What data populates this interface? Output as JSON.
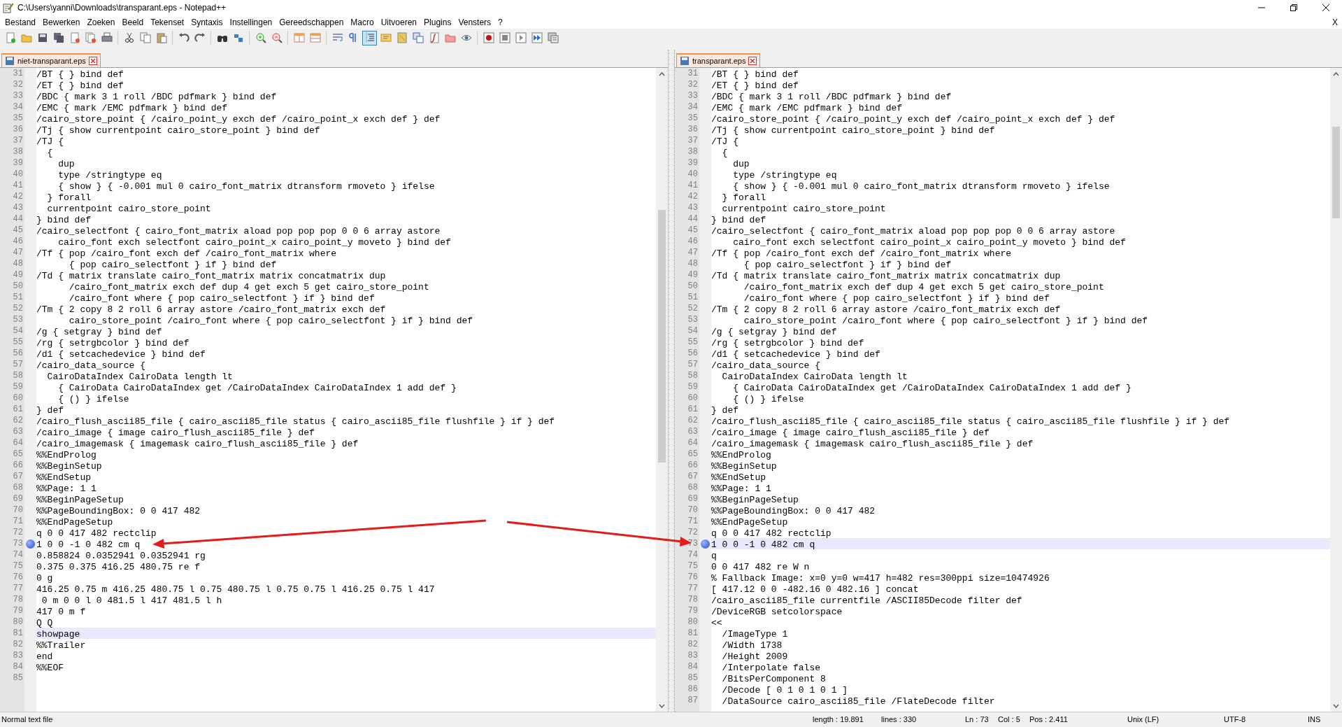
{
  "window": {
    "title": "C:\\Users\\yanni\\Downloads\\transparant.eps - Notepad++"
  },
  "menu": [
    "Bestand",
    "Bewerken",
    "Zoeken",
    "Beeld",
    "Tekenset",
    "Syntaxis",
    "Instellingen",
    "Gereedschappen",
    "Macro",
    "Uitvoeren",
    "Plugins",
    "Vensters",
    "?"
  ],
  "menu_close": "X",
  "toolbar": [
    {
      "pressed": false
    },
    {
      "pressed": false
    },
    {
      "pressed": false
    },
    {
      "pressed": false
    },
    {
      "pressed": false
    },
    {
      "pressed": false
    },
    {
      "pressed": false
    },
    {
      "pressed": false
    },
    {
      "pressed": false
    },
    {
      "pressed": false
    },
    {
      "pressed": false
    },
    {
      "pressed": false
    },
    {
      "pressed": false
    },
    {
      "pressed": false
    },
    {
      "pressed": false
    },
    {
      "pressed": false
    },
    {
      "pressed": false
    },
    {
      "pressed": false
    },
    {
      "pressed": false
    },
    {
      "pressed": false
    },
    {
      "pressed": true
    },
    {
      "pressed": false
    },
    {
      "pressed": false
    },
    {
      "pressed": false
    },
    {
      "pressed": false
    },
    {
      "pressed": false
    },
    {
      "pressed": false
    },
    {
      "pressed": false
    },
    {
      "pressed": false
    },
    {
      "pressed": false
    },
    {
      "pressed": false
    },
    {
      "pressed": false
    }
  ],
  "panes": [
    {
      "tab": {
        "label": "niet-transparant.eps",
        "selected": true
      },
      "lines": [
        {
          "n": "31",
          "text": "/BT { } bind def",
          "bookmark": false,
          "current": false
        },
        {
          "n": "32",
          "text": "/ET { } bind def",
          "bookmark": false,
          "current": false
        },
        {
          "n": "33",
          "text": "/BDC { mark 3 1 roll /BDC pdfmark } bind def",
          "bookmark": false,
          "current": false
        },
        {
          "n": "34",
          "text": "/EMC { mark /EMC pdfmark } bind def",
          "bookmark": false,
          "current": false
        },
        {
          "n": "35",
          "text": "/cairo_store_point { /cairo_point_y exch def /cairo_point_x exch def } def",
          "bookmark": false,
          "current": false
        },
        {
          "n": "36",
          "text": "/Tj { show currentpoint cairo_store_point } bind def",
          "bookmark": false,
          "current": false
        },
        {
          "n": "37",
          "text": "/TJ {",
          "bookmark": false,
          "current": false
        },
        {
          "n": "38",
          "text": "  {",
          "bookmark": false,
          "current": false
        },
        {
          "n": "39",
          "text": "    dup",
          "bookmark": false,
          "current": false
        },
        {
          "n": "40",
          "text": "    type /stringtype eq",
          "bookmark": false,
          "current": false
        },
        {
          "n": "41",
          "text": "    { show } { -0.001 mul 0 cairo_font_matrix dtransform rmoveto } ifelse",
          "bookmark": false,
          "current": false
        },
        {
          "n": "42",
          "text": "  } forall",
          "bookmark": false,
          "current": false
        },
        {
          "n": "43",
          "text": "  currentpoint cairo_store_point",
          "bookmark": false,
          "current": false
        },
        {
          "n": "44",
          "text": "} bind def",
          "bookmark": false,
          "current": false
        },
        {
          "n": "45",
          "text": "/cairo_selectfont { cairo_font_matrix aload pop pop pop 0 0 6 array astore",
          "bookmark": false,
          "current": false
        },
        {
          "n": "46",
          "text": "    cairo_font exch selectfont cairo_point_x cairo_point_y moveto } bind def",
          "bookmark": false,
          "current": false
        },
        {
          "n": "47",
          "text": "/Tf { pop /cairo_font exch def /cairo_font_matrix where",
          "bookmark": false,
          "current": false
        },
        {
          "n": "48",
          "text": "      { pop cairo_selectfont } if } bind def",
          "bookmark": false,
          "current": false
        },
        {
          "n": "49",
          "text": "/Td { matrix translate cairo_font_matrix matrix concatmatrix dup",
          "bookmark": false,
          "current": false
        },
        {
          "n": "50",
          "text": "      /cairo_font_matrix exch def dup 4 get exch 5 get cairo_store_point",
          "bookmark": false,
          "current": false
        },
        {
          "n": "51",
          "text": "      /cairo_font where { pop cairo_selectfont } if } bind def",
          "bookmark": false,
          "current": false
        },
        {
          "n": "52",
          "text": "/Tm { 2 copy 8 2 roll 6 array astore /cairo_font_matrix exch def",
          "bookmark": false,
          "current": false
        },
        {
          "n": "53",
          "text": "      cairo_store_point /cairo_font where { pop cairo_selectfont } if } bind def",
          "bookmark": false,
          "current": false
        },
        {
          "n": "54",
          "text": "/g { setgray } bind def",
          "bookmark": false,
          "current": false
        },
        {
          "n": "55",
          "text": "/rg { setrgbcolor } bind def",
          "bookmark": false,
          "current": false
        },
        {
          "n": "56",
          "text": "/d1 { setcachedevice } bind def",
          "bookmark": false,
          "current": false
        },
        {
          "n": "57",
          "text": "/cairo_data_source {",
          "bookmark": false,
          "current": false
        },
        {
          "n": "58",
          "text": "  CairoDataIndex CairoData length lt",
          "bookmark": false,
          "current": false
        },
        {
          "n": "59",
          "text": "    { CairoData CairoDataIndex get /CairoDataIndex CairoDataIndex 1 add def }",
          "bookmark": false,
          "current": false
        },
        {
          "n": "60",
          "text": "    { () } ifelse",
          "bookmark": false,
          "current": false
        },
        {
          "n": "61",
          "text": "} def",
          "bookmark": false,
          "current": false
        },
        {
          "n": "62",
          "text": "/cairo_flush_ascii85_file { cairo_ascii85_file status { cairo_ascii85_file flushfile } if } def",
          "bookmark": false,
          "current": false
        },
        {
          "n": "63",
          "text": "/cairo_image { image cairo_flush_ascii85_file } def",
          "bookmark": false,
          "current": false
        },
        {
          "n": "64",
          "text": "/cairo_imagemask { imagemask cairo_flush_ascii85_file } def",
          "bookmark": false,
          "current": false
        },
        {
          "n": "65",
          "text": "%%EndProlog",
          "bookmark": false,
          "current": false
        },
        {
          "n": "66",
          "text": "%%BeginSetup",
          "bookmark": false,
          "current": false
        },
        {
          "n": "67",
          "text": "%%EndSetup",
          "bookmark": false,
          "current": false
        },
        {
          "n": "68",
          "text": "%%Page: 1 1",
          "bookmark": false,
          "current": false
        },
        {
          "n": "69",
          "text": "%%BeginPageSetup",
          "bookmark": false,
          "current": false
        },
        {
          "n": "70",
          "text": "%%PageBoundingBox: 0 0 417 482",
          "bookmark": false,
          "current": false
        },
        {
          "n": "71",
          "text": "%%EndPageSetup",
          "bookmark": false,
          "current": false
        },
        {
          "n": "72",
          "text": "q 0 0 417 482 rectclip",
          "bookmark": false,
          "current": false
        },
        {
          "n": "73",
          "text": "1 0 0 -1 0 482 cm q",
          "bookmark": true,
          "current": false
        },
        {
          "n": "74",
          "text": "0.858824 0.0352941 0.0352941 rg",
          "bookmark": false,
          "current": false
        },
        {
          "n": "75",
          "text": "0.375 0.375 416.25 480.75 re f",
          "bookmark": false,
          "current": false
        },
        {
          "n": "76",
          "text": "0 g",
          "bookmark": false,
          "current": false
        },
        {
          "n": "77",
          "text": "416.25 0.75 m 416.25 480.75 l 0.75 480.75 l 0.75 0.75 l 416.25 0.75 l 417",
          "bookmark": false,
          "current": false
        },
        {
          "n": "78",
          "text": " 0 m 0 0 l 0 481.5 l 417 481.5 l h",
          "bookmark": false,
          "current": false
        },
        {
          "n": "79",
          "text": "417 0 m f",
          "bookmark": false,
          "current": false
        },
        {
          "n": "80",
          "text": "Q Q",
          "bookmark": false,
          "current": false
        },
        {
          "n": "81",
          "text": "showpage",
          "bookmark": false,
          "current": true
        },
        {
          "n": "82",
          "text": "%%Trailer",
          "bookmark": false,
          "current": false
        },
        {
          "n": "83",
          "text": "end",
          "bookmark": false,
          "current": false
        },
        {
          "n": "84",
          "text": "%%EOF",
          "bookmark": false,
          "current": false
        },
        {
          "n": "85",
          "bookmark": false,
          "current": false
        }
      ]
    },
    {
      "tab": {
        "label": "transparant.eps",
        "selected": true
      },
      "lines": [
        {
          "n": "31",
          "text": "/BT { } bind def",
          "bookmark": false,
          "current": false
        },
        {
          "n": "32",
          "text": "/ET { } bind def",
          "bookmark": false,
          "current": false
        },
        {
          "n": "33",
          "text": "/BDC { mark 3 1 roll /BDC pdfmark } bind def",
          "bookmark": false,
          "current": false
        },
        {
          "n": "34",
          "text": "/EMC { mark /EMC pdfmark } bind def",
          "bookmark": false,
          "current": false
        },
        {
          "n": "35",
          "text": "/cairo_store_point { /cairo_point_y exch def /cairo_point_x exch def } def",
          "bookmark": false,
          "current": false
        },
        {
          "n": "36",
          "text": "/Tj { show currentpoint cairo_store_point } bind def",
          "bookmark": false,
          "current": false
        },
        {
          "n": "37",
          "text": "/TJ {",
          "bookmark": false,
          "current": false
        },
        {
          "n": "38",
          "text": "  {",
          "bookmark": false,
          "current": false
        },
        {
          "n": "39",
          "text": "    dup",
          "bookmark": false,
          "current": false
        },
        {
          "n": "40",
          "text": "    type /stringtype eq",
          "bookmark": false,
          "current": false
        },
        {
          "n": "41",
          "text": "    { show } { -0.001 mul 0 cairo_font_matrix dtransform rmoveto } ifelse",
          "bookmark": false,
          "current": false
        },
        {
          "n": "42",
          "text": "  } forall",
          "bookmark": false,
          "current": false
        },
        {
          "n": "43",
          "text": "  currentpoint cairo_store_point",
          "bookmark": false,
          "current": false
        },
        {
          "n": "44",
          "text": "} bind def",
          "bookmark": false,
          "current": false
        },
        {
          "n": "45",
          "text": "/cairo_selectfont { cairo_font_matrix aload pop pop pop 0 0 6 array astore",
          "bookmark": false,
          "current": false
        },
        {
          "n": "46",
          "text": "    cairo_font exch selectfont cairo_point_x cairo_point_y moveto } bind def",
          "bookmark": false,
          "current": false
        },
        {
          "n": "47",
          "text": "/Tf { pop /cairo_font exch def /cairo_font_matrix where",
          "bookmark": false,
          "current": false
        },
        {
          "n": "48",
          "text": "      { pop cairo_selectfont } if } bind def",
          "bookmark": false,
          "current": false
        },
        {
          "n": "49",
          "text": "/Td { matrix translate cairo_font_matrix matrix concatmatrix dup",
          "bookmark": false,
          "current": false
        },
        {
          "n": "50",
          "text": "      /cairo_font_matrix exch def dup 4 get exch 5 get cairo_store_point",
          "bookmark": false,
          "current": false
        },
        {
          "n": "51",
          "text": "      /cairo_font where { pop cairo_selectfont } if } bind def",
          "bookmark": false,
          "current": false
        },
        {
          "n": "52",
          "text": "/Tm { 2 copy 8 2 roll 6 array astore /cairo_font_matrix exch def",
          "bookmark": false,
          "current": false
        },
        {
          "n": "53",
          "text": "      cairo_store_point /cairo_font where { pop cairo_selectfont } if } bind def",
          "bookmark": false,
          "current": false
        },
        {
          "n": "54",
          "text": "/g { setgray } bind def",
          "bookmark": false,
          "current": false
        },
        {
          "n": "55",
          "text": "/rg { setrgbcolor } bind def",
          "bookmark": false,
          "current": false
        },
        {
          "n": "56",
          "text": "/d1 { setcachedevice } bind def",
          "bookmark": false,
          "current": false
        },
        {
          "n": "57",
          "text": "/cairo_data_source {",
          "bookmark": false,
          "current": false
        },
        {
          "n": "58",
          "text": "  CairoDataIndex CairoData length lt",
          "bookmark": false,
          "current": false
        },
        {
          "n": "59",
          "text": "    { CairoData CairoDataIndex get /CairoDataIndex CairoDataIndex 1 add def }",
          "bookmark": false,
          "current": false
        },
        {
          "n": "60",
          "text": "    { () } ifelse",
          "bookmark": false,
          "current": false
        },
        {
          "n": "61",
          "text": "} def",
          "bookmark": false,
          "current": false
        },
        {
          "n": "62",
          "text": "/cairo_flush_ascii85_file { cairo_ascii85_file status { cairo_ascii85_file flushfile } if } def",
          "bookmark": false,
          "current": false
        },
        {
          "n": "63",
          "text": "/cairo_image { image cairo_flush_ascii85_file } def",
          "bookmark": false,
          "current": false
        },
        {
          "n": "64",
          "text": "/cairo_imagemask { imagemask cairo_flush_ascii85_file } def",
          "bookmark": false,
          "current": false
        },
        {
          "n": "65",
          "text": "%%EndProlog",
          "bookmark": false,
          "current": false
        },
        {
          "n": "66",
          "text": "%%BeginSetup",
          "bookmark": false,
          "current": false
        },
        {
          "n": "67",
          "text": "%%EndSetup",
          "bookmark": false,
          "current": false
        },
        {
          "n": "68",
          "text": "%%Page: 1 1",
          "bookmark": false,
          "current": false
        },
        {
          "n": "69",
          "text": "%%BeginPageSetup",
          "bookmark": false,
          "current": false
        },
        {
          "n": "70",
          "text": "%%PageBoundingBox: 0 0 417 482",
          "bookmark": false,
          "current": false
        },
        {
          "n": "71",
          "text": "%%EndPageSetup",
          "bookmark": false,
          "current": false
        },
        {
          "n": "72",
          "text": "q 0 0 417 482 rectclip",
          "bookmark": false,
          "current": false
        },
        {
          "n": "73",
          "text": "1 0 0 -1 0 482 cm q",
          "bookmark": true,
          "current": true
        },
        {
          "n": "74",
          "text": "q",
          "bookmark": false,
          "current": false
        },
        {
          "n": "75",
          "text": "0 0 417 482 re W n",
          "bookmark": false,
          "current": false
        },
        {
          "n": "76",
          "text": "% Fallback Image: x=0 y=0 w=417 h=482 res=300ppi size=10474926",
          "bookmark": false,
          "current": false
        },
        {
          "n": "77",
          "text": "[ 417.12 0 0 -482.16 0 482.16 ] concat",
          "bookmark": false,
          "current": false
        },
        {
          "n": "78",
          "text": "/cairo_ascii85_file currentfile /ASCII85Decode filter def",
          "bookmark": false,
          "current": false
        },
        {
          "n": "79",
          "text": "/DeviceRGB setcolorspace",
          "bookmark": false,
          "current": false
        },
        {
          "n": "80",
          "text": "<<",
          "bookmark": false,
          "current": false
        },
        {
          "n": "81",
          "text": "  /ImageType 1",
          "bookmark": false,
          "current": false
        },
        {
          "n": "82",
          "text": "  /Width 1738",
          "bookmark": false,
          "current": false
        },
        {
          "n": "83",
          "text": "  /Height 2009",
          "bookmark": false,
          "current": false
        },
        {
          "n": "84",
          "text": "  /Interpolate false",
          "bookmark": false,
          "current": false
        },
        {
          "n": "85",
          "text": "  /BitsPerComponent 8",
          "bookmark": false,
          "current": false
        },
        {
          "n": "86",
          "text": "  /Decode [ 0 1 0 1 0 1 ]",
          "bookmark": false,
          "current": false
        },
        {
          "n": "87",
          "text": "  /DataSource cairo_ascii85_file /FlateDecode filter",
          "bookmark": false,
          "current": false
        }
      ]
    }
  ],
  "status_bar": {
    "file_type": "Normal text file",
    "length": "length : 19.891",
    "lines": "lines : 330",
    "ln": "Ln : 73",
    "col": "Col : 5",
    "pos": "Pos : 2.411",
    "eol": "Unix (LF)",
    "encoding": "UTF-8",
    "mode": "INS"
  }
}
